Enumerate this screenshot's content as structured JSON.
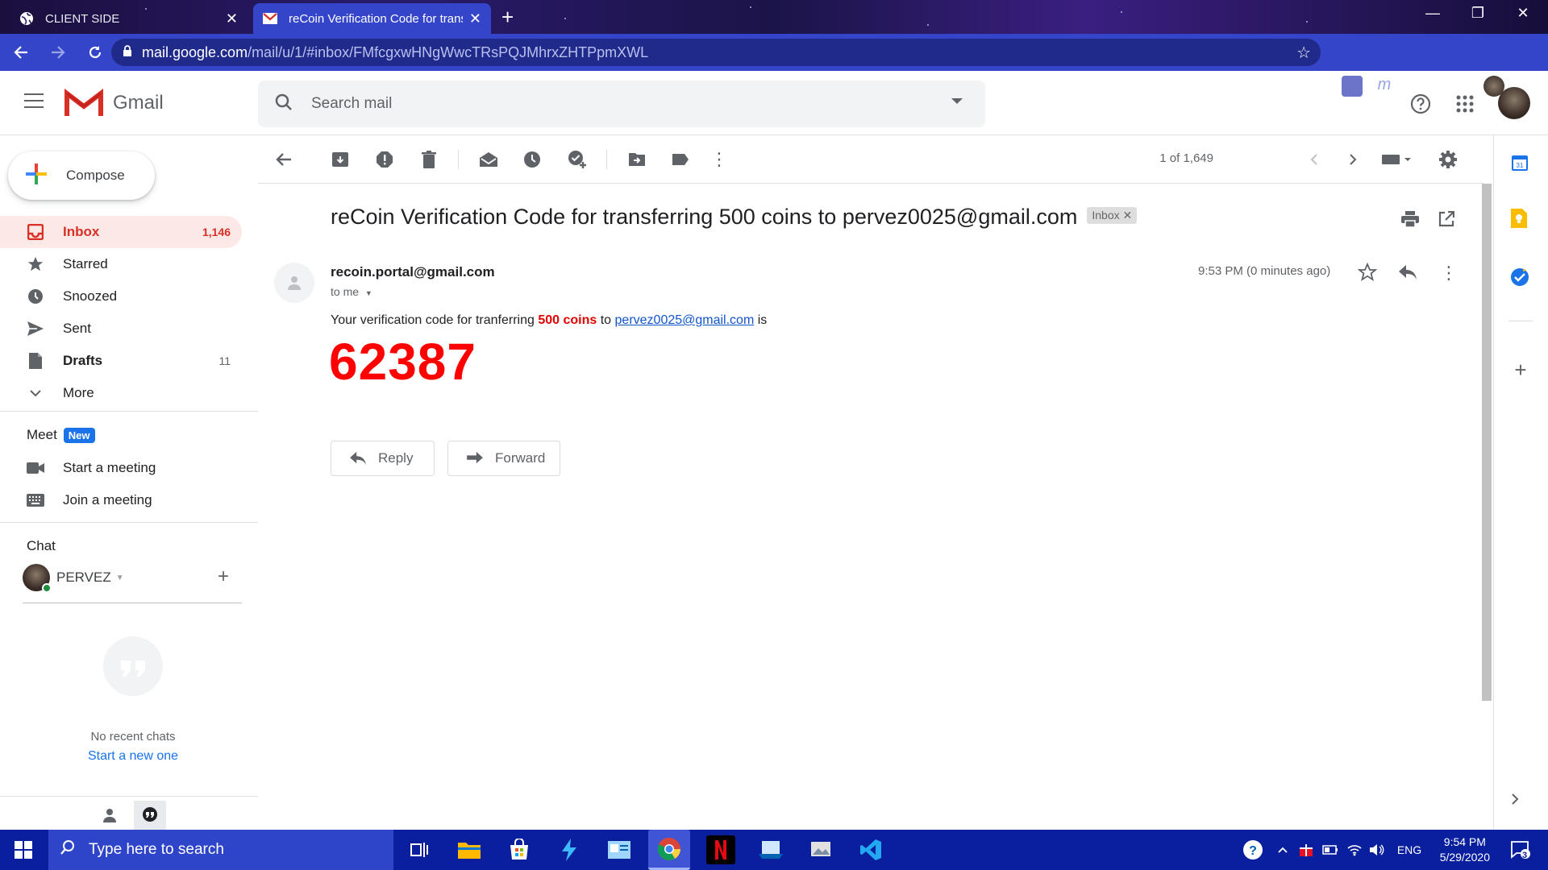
{
  "browser": {
    "tabs": [
      {
        "title": "CLIENT SIDE",
        "active": false
      },
      {
        "title": "reCoin Verification Code for trans",
        "active": true
      }
    ],
    "url_host": "mail.google.com",
    "url_path": "/mail/u/1/#inbox/FMfcgxwHNgWwcTRsPQJMhrxZHTPpmXWL"
  },
  "header": {
    "product": "Gmail",
    "search_placeholder": "Search mail"
  },
  "sidebar": {
    "compose_label": "Compose",
    "items": [
      {
        "label": "Inbox",
        "count": "1,146",
        "icon": "inbox-icon"
      },
      {
        "label": "Starred",
        "count": "",
        "icon": "star-icon"
      },
      {
        "label": "Snoozed",
        "count": "",
        "icon": "clock-icon"
      },
      {
        "label": "Sent",
        "count": "",
        "icon": "send-icon"
      },
      {
        "label": "Drafts",
        "count": "11",
        "icon": "draft-icon"
      },
      {
        "label": "More",
        "count": "",
        "icon": "chevron-down-icon"
      }
    ],
    "meet": {
      "title": "Meet",
      "badge": "New",
      "start": "Start a meeting",
      "join": "Join a meeting"
    },
    "chat": {
      "title": "Chat",
      "user": "PERVEZ",
      "empty_text": "No recent chats",
      "start_link": "Start a new one"
    }
  },
  "toolbar": {
    "pager": "1 of 1,649"
  },
  "message": {
    "subject": "reCoin Verification Code for transferring 500 coins to pervez0025@gmail.com",
    "label": "Inbox",
    "sender": "recoin.portal@gmail.com",
    "to": "to me",
    "time": "9:53 PM (0 minutes ago)",
    "body_prefix": "Your verification code for tranferring",
    "body_amount": "500 coins",
    "body_to": "to",
    "body_email": "pervez0025@gmail.com",
    "body_suffix": "is",
    "code": "62387",
    "reply_label": "Reply",
    "forward_label": "Forward"
  },
  "taskbar": {
    "search_placeholder": "Type here to search",
    "language": "ENG",
    "time": "9:54 PM",
    "date": "5/29/2020",
    "notification_count": "3"
  },
  "colors": {
    "gmail_red": "#d93025",
    "code_red": "#ff0000",
    "browser_blue": "#3545c9",
    "taskbar_blue": "#0a1f9e"
  }
}
